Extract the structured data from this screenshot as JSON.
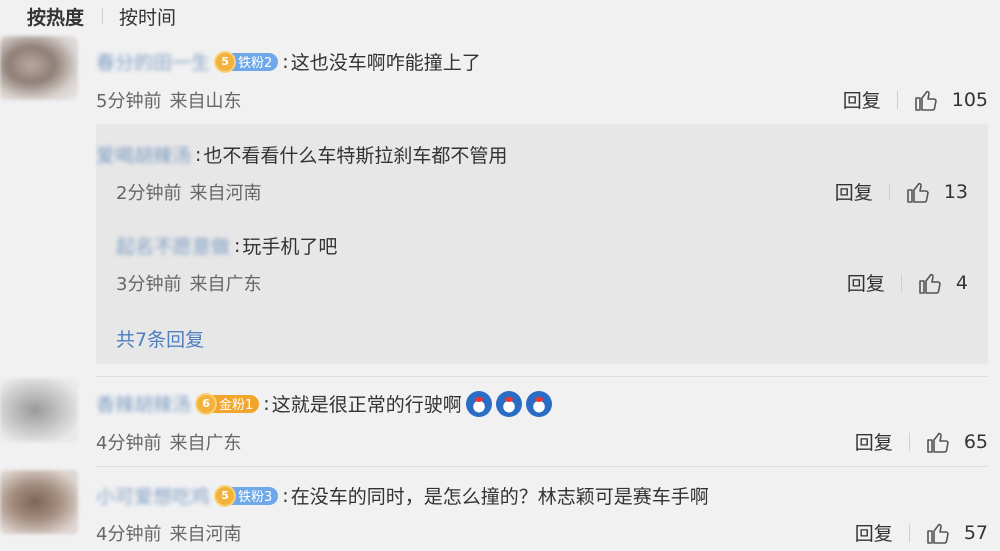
{
  "sort": {
    "hot": "按热度",
    "time": "按时间"
  },
  "comments": [
    {
      "user": "春分的田一生",
      "badge_level": "5",
      "badge_label": "铁粉2",
      "text": "这也没车啊咋能撞上了",
      "time": "5分钟前",
      "location": "来自山东",
      "reply_label": "回复",
      "likes": "105"
    },
    {
      "user": "香辣胡辣汤",
      "badge_level": "6",
      "badge_label": "金粉1",
      "text": "这就是很正常的行驶啊",
      "time": "4分钟前",
      "location": "来自广东",
      "reply_label": "回复",
      "likes": "65"
    },
    {
      "user": "小可爱想吃鸡",
      "badge_level": "5",
      "badge_label": "铁粉3",
      "text": "在没车的同时，是怎么撞的？林志颖可是赛车手啊",
      "time": "4分钟前",
      "location": "来自河南",
      "reply_label": "回复",
      "likes": "57"
    }
  ],
  "replies": [
    {
      "user": "爱喝胡辣汤",
      "text": "也不看看什么车特斯拉刹车都不管用",
      "time": "2分钟前",
      "location": "来自河南",
      "reply_label": "回复",
      "likes": "13"
    },
    {
      "user": "起名不愿意做",
      "text": "玩手机了吧",
      "time": "3分钟前",
      "location": "来自广东",
      "reply_label": "回复",
      "likes": "4"
    }
  ],
  "more_replies": "共7条回复",
  "colors": {
    "link": "#4f7fbf",
    "iron_badge": "#6fa8e8",
    "gold_badge": "#f2a52c"
  },
  "icons": {
    "like": "thumbs-up-icon",
    "emoji": "doraemon-emoji"
  }
}
